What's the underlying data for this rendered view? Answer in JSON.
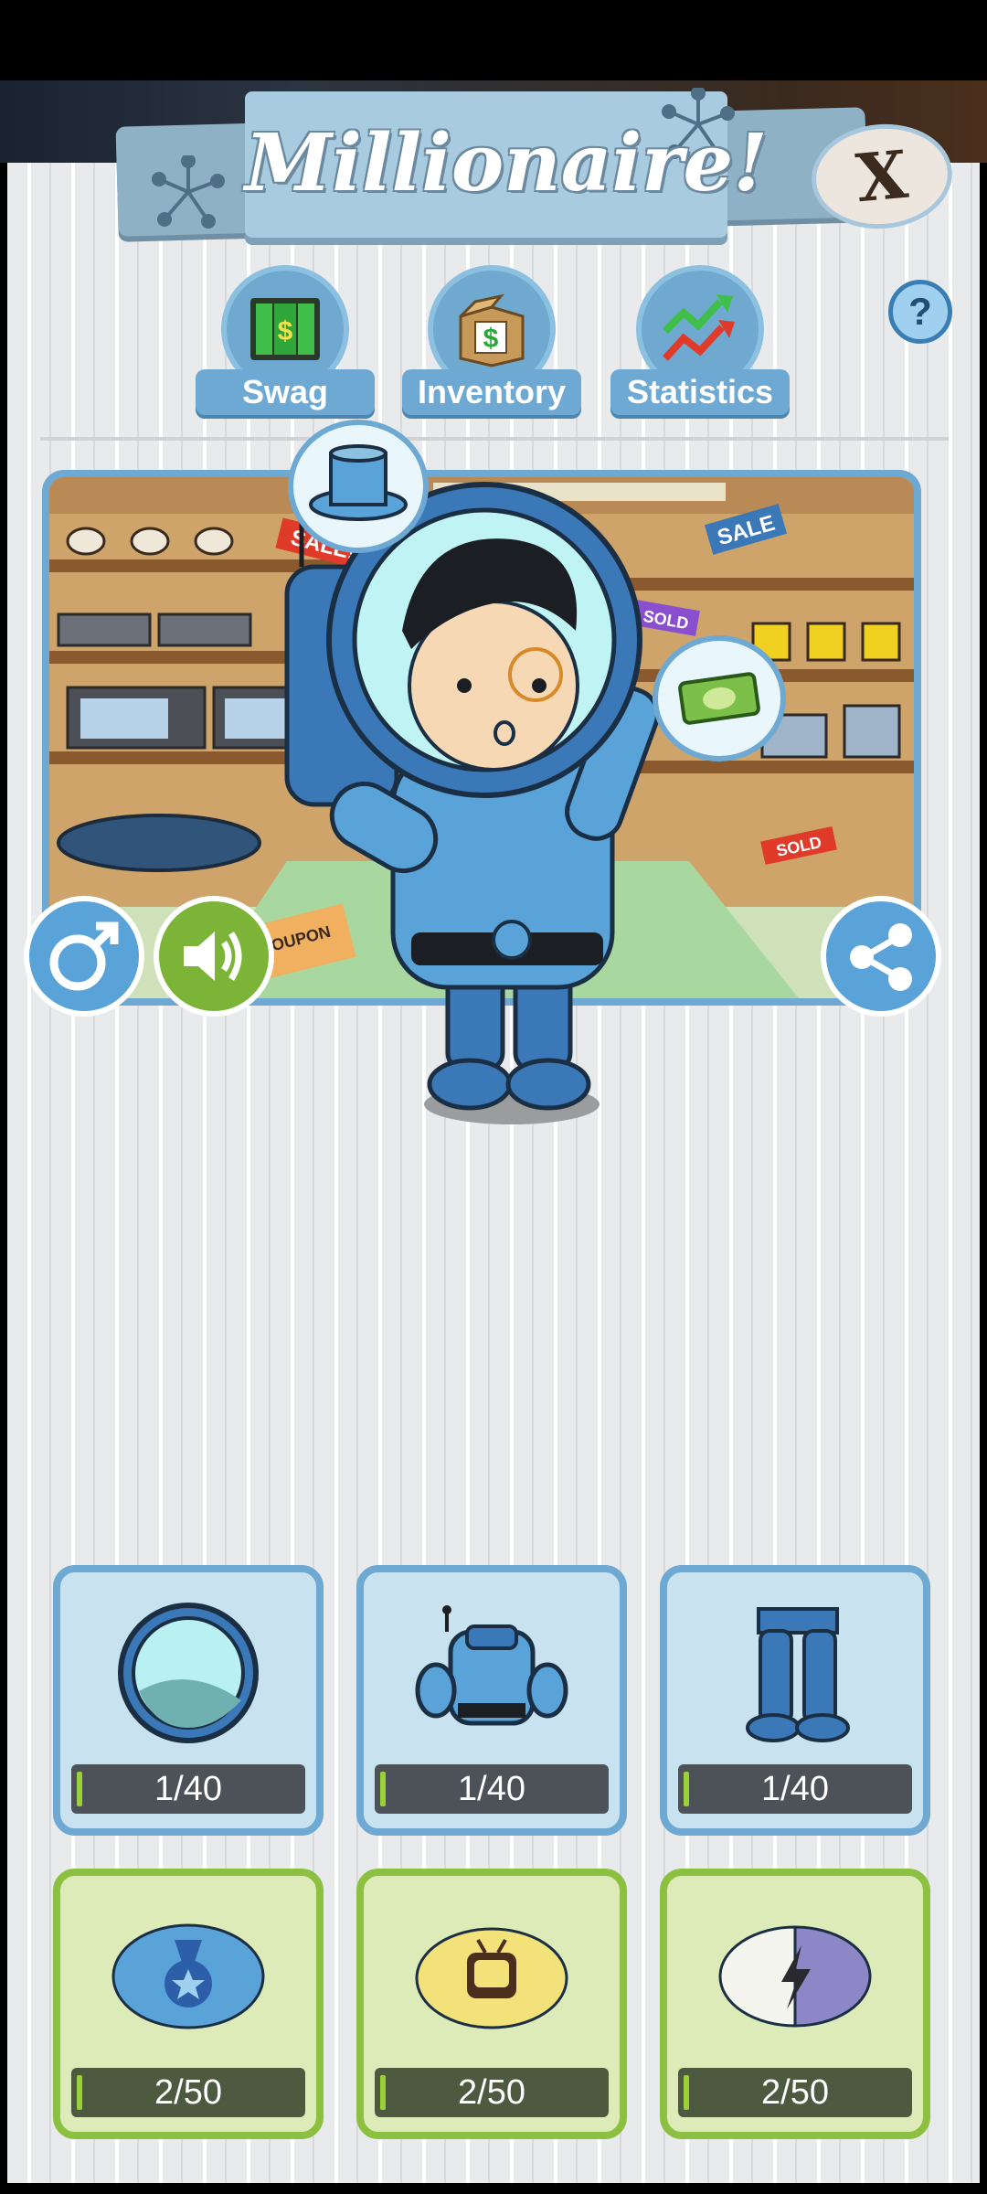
{
  "title": "Millionaire!",
  "close_label": "X",
  "help_label": "?",
  "tabs": [
    {
      "label": "Swag"
    },
    {
      "label": "Inventory"
    },
    {
      "label": "Statistics"
    }
  ],
  "scene": {
    "sale_signs": [
      "SALE!",
      "SALE",
      "SOLD",
      "SOLD",
      "COUPON"
    ]
  },
  "slots": [
    {
      "name": "helmet",
      "count": "1/40",
      "progress": 0.025
    },
    {
      "name": "suit-torso",
      "count": "1/40",
      "progress": 0.025
    },
    {
      "name": "suit-pants",
      "count": "1/40",
      "progress": 0.025
    },
    {
      "name": "medal",
      "count": "2/50",
      "progress": 0.04
    },
    {
      "name": "tv",
      "count": "2/50",
      "progress": 0.04
    },
    {
      "name": "lightning",
      "count": "2/50",
      "progress": 0.04
    }
  ],
  "colors": {
    "accent_blue": "#6ea9d3",
    "accent_green": "#8cc040",
    "progress_fill": "#9ad03a"
  }
}
